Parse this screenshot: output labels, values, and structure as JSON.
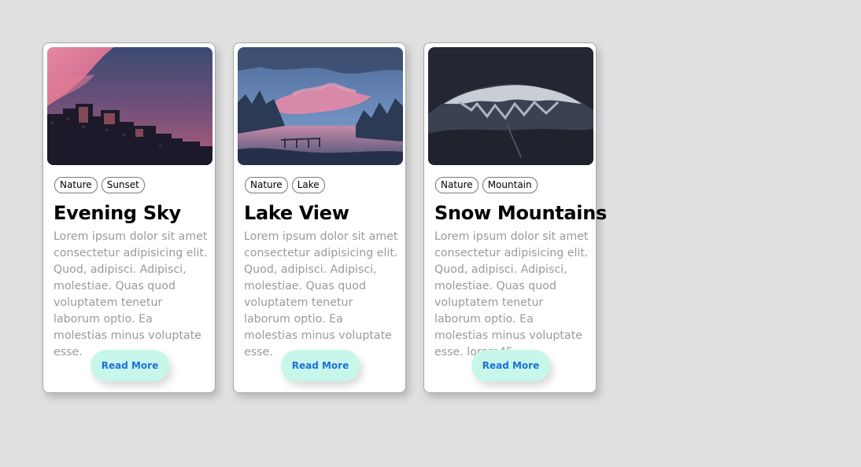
{
  "colors": {
    "background": "#e0e0e0",
    "card": "#ffffff",
    "button_bg": "#c6f7ea",
    "button_text": "#1e6fd9",
    "body_text": "#9a9a9a"
  },
  "cards": [
    {
      "image": "sunset-city-illustration",
      "tags": [
        "Nature",
        "Sunset"
      ],
      "title": "Evening Sky",
      "text": "Lorem ipsum dolor sit amet consectetur adipisicing elit. Quod, adipisci. Adipisci, molestiae. Quas quod voluptatem tenetur laborum optio. Ea molestias minus voluptate esse.",
      "button": "Read More"
    },
    {
      "image": "lake-dock-illustration",
      "tags": [
        "Nature",
        "Lake"
      ],
      "title": "Lake View",
      "text": "Lorem ipsum dolor sit amet consectetur adipisicing elit. Quod, adipisci. Adipisci, molestiae. Quas quod voluptatem tenetur laborum optio. Ea molestias minus voluptate esse.",
      "button": "Read More"
    },
    {
      "image": "snow-mountain-illustration",
      "tags": [
        "Nature",
        "Mountain"
      ],
      "title": "Snow Mountains",
      "text": "Lorem ipsum dolor sit amet consectetur adipisicing elit. Quod, adipisci. Adipisci, molestiae. Quas quod voluptatem tenetur laborum optio. Ea molestias minus voluptate esse. lorem45",
      "button": "Read More"
    }
  ]
}
